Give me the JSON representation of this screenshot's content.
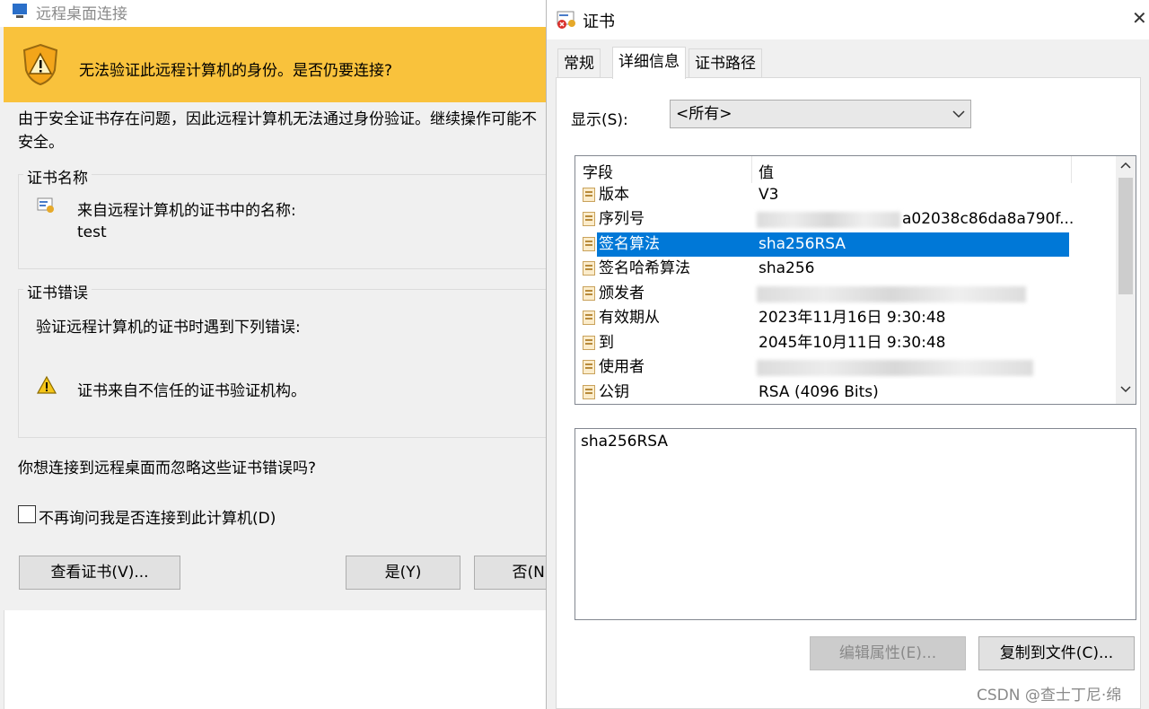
{
  "rdp": {
    "title": "远程桌面连接",
    "banner_text": "无法验证此远程计算机的身份。是否仍要连接?",
    "description": "由于安全证书存在问题，因此远程计算机无法通过身份验证。继续操作可能不安全。",
    "cert_name_group": {
      "label": "证书名称",
      "caption": "来自远程计算机的证书中的名称:",
      "value": "test"
    },
    "cert_error_group": {
      "label": "证书错误",
      "caption": "验证远程计算机的证书时遇到下列错误:",
      "error": "证书来自不信任的证书验证机构。"
    },
    "question": "你想连接到远程桌面而忽略这些证书错误吗?",
    "checkbox_label": "不再询问我是否连接到此计算机(D)",
    "buttons": {
      "view_cert": "查看证书(V)...",
      "yes": "是(Y)",
      "no": "否(N)"
    }
  },
  "cert": {
    "title": "证书",
    "tabs": [
      "常规",
      "详细信息",
      "证书路径"
    ],
    "show_label": "显示(S):",
    "show_value": "<所有>",
    "columns": [
      "字段",
      "值"
    ],
    "rows": [
      {
        "field": "版本",
        "value": "V3"
      },
      {
        "field": "序列号",
        "value": "a02038c86da8a790f..."
      },
      {
        "field": "签名算法",
        "value": "sha256RSA"
      },
      {
        "field": "签名哈希算法",
        "value": "sha256"
      },
      {
        "field": "颁发者",
        "value": ""
      },
      {
        "field": "有效期从",
        "value": "2023年11月16日 9:30:48"
      },
      {
        "field": "到",
        "value": "2045年10月11日 9:30:48"
      },
      {
        "field": "使用者",
        "value": ""
      },
      {
        "field": "公钥",
        "value": "RSA (4096 Bits)"
      }
    ],
    "detail_value": "sha256RSA",
    "buttons": {
      "edit_props": "编辑属性(E)...",
      "copy_to_file": "复制到文件(C)..."
    },
    "close_glyph": "✕"
  },
  "watermark": "CSDN @查士丁尼·绵",
  "colors": {
    "banner": "#f9c23c",
    "selection": "#0078d7"
  }
}
